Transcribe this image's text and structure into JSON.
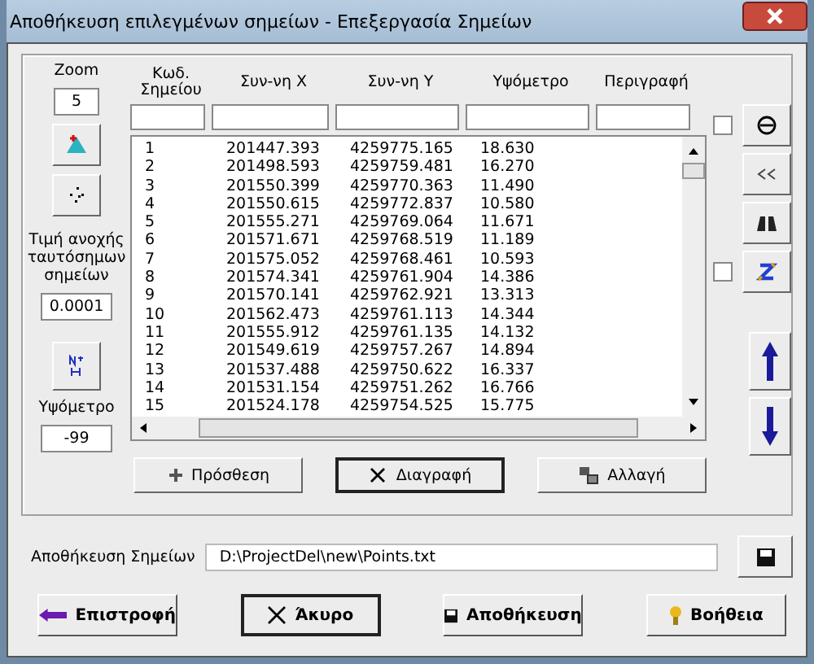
{
  "window": {
    "title": "Αποθήκευση επιλεγμένων σημείων - Επεξεργασία Σημείων"
  },
  "zoom": {
    "label": "Zoom",
    "value": "5"
  },
  "tolerance": {
    "label": "Τιμή ανοχής ταυτόσημων σημείων",
    "value": "0.0001"
  },
  "elevation": {
    "label": "Υψόμετρο",
    "value": "-99"
  },
  "table": {
    "columns": [
      "Κωδ. Σημείου",
      "Συν-νη X",
      "Συν-νη Y",
      "Υψόμετρο",
      "Περιγραφή"
    ],
    "rows": [
      [
        "1",
        "201447.393",
        "4259775.165",
        "18.630"
      ],
      [
        "2",
        "201498.593",
        "4259759.481",
        "16.270"
      ],
      [
        "3",
        "201550.399",
        "4259770.363",
        "11.490"
      ],
      [
        "4",
        "201550.615",
        "4259772.837",
        "10.580"
      ],
      [
        "5",
        "201555.271",
        "4259769.064",
        "11.671"
      ],
      [
        "6",
        "201571.671",
        "4259768.519",
        "11.189"
      ],
      [
        "7",
        "201575.052",
        "4259768.461",
        "10.593"
      ],
      [
        "8",
        "201574.341",
        "4259761.904",
        "14.386"
      ],
      [
        "9",
        "201570.141",
        "4259762.921",
        "13.313"
      ],
      [
        "10",
        "201562.473",
        "4259761.113",
        "14.344"
      ],
      [
        "11",
        "201555.912",
        "4259761.135",
        "14.132"
      ],
      [
        "12",
        "201549.619",
        "4259757.267",
        "14.894"
      ],
      [
        "13",
        "201537.488",
        "4259750.622",
        "16.337"
      ],
      [
        "14",
        "201531.154",
        "4259751.262",
        "16.766"
      ],
      [
        "15",
        "201524.178",
        "4259754.525",
        "15.775"
      ]
    ]
  },
  "right_checks": [
    {
      "checked": false
    },
    {
      "checked": false
    }
  ],
  "edit_buttons": [
    {
      "label": "Πρόσθεση",
      "kind": "add",
      "selected": false
    },
    {
      "label": "Διαγραφή",
      "kind": "delete",
      "selected": true
    },
    {
      "label": "Αλλαγή",
      "kind": "change",
      "selected": false
    }
  ],
  "save_points": {
    "label": "Αποθήκευση Σημείων",
    "value": "D:\\ProjectDel\\new\\Points.txt"
  },
  "bottom_buttons": [
    {
      "label": "Επιστροφή",
      "kind": "back",
      "selected": false
    },
    {
      "label": "Άκυρο",
      "kind": "cancel",
      "selected": true
    },
    {
      "label": "Αποθήκευση",
      "kind": "save",
      "selected": false
    },
    {
      "label": "Βοήθεια",
      "kind": "help",
      "selected": false
    }
  ]
}
